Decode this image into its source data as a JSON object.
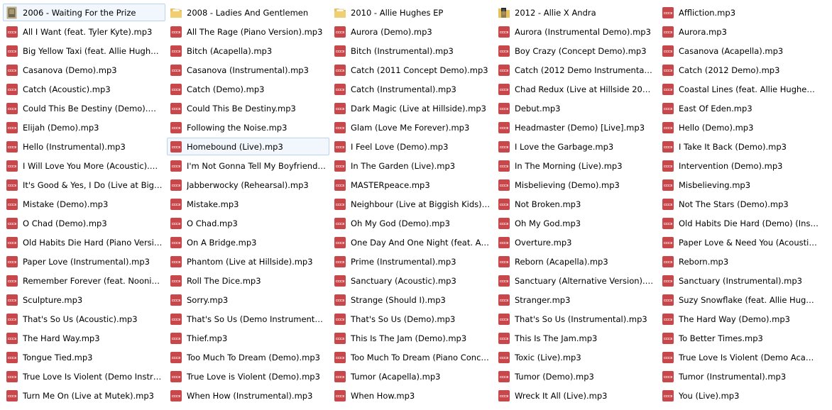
{
  "window": {
    "view": "list"
  },
  "colors": {
    "mp3_icon": "#c8474a",
    "folder": "#e8c060",
    "selection_bg": "#f1f7fd",
    "selection_border": "#b9d4ef"
  },
  "items": [
    {
      "label": "2006 - Waiting For the Prize",
      "type": "folder",
      "icon": "folder-image-icon",
      "state": "selected"
    },
    {
      "label": "All I Want (feat. Tyler Kyte).mp3",
      "type": "mp3",
      "icon": "mp3-file-icon"
    },
    {
      "label": "Big Yellow Taxi (feat. Allie Hughes)....",
      "type": "mp3",
      "icon": "mp3-file-icon"
    },
    {
      "label": "Casanova (Demo).mp3",
      "type": "mp3",
      "icon": "mp3-file-icon"
    },
    {
      "label": "Catch (Acoustic).mp3",
      "type": "mp3",
      "icon": "mp3-file-icon"
    },
    {
      "label": "Could This Be Destiny (Demo).mp3",
      "type": "mp3",
      "icon": "mp3-file-icon"
    },
    {
      "label": "Elijah (Demo).mp3",
      "type": "mp3",
      "icon": "mp3-file-icon"
    },
    {
      "label": "Hello (Instrumental).mp3",
      "type": "mp3",
      "icon": "mp3-file-icon"
    },
    {
      "label": "I Will Love You More (Acoustic).mp3",
      "type": "mp3",
      "icon": "mp3-file-icon"
    },
    {
      "label": "It's Good & Yes, I Do (Live at Biggis...",
      "type": "mp3",
      "icon": "mp3-file-icon"
    },
    {
      "label": "Mistake (Demo).mp3",
      "type": "mp3",
      "icon": "mp3-file-icon"
    },
    {
      "label": "O Chad (Demo).mp3",
      "type": "mp3",
      "icon": "mp3-file-icon"
    },
    {
      "label": "Old Habits Die Hard (Piano Version...",
      "type": "mp3",
      "icon": "mp3-file-icon"
    },
    {
      "label": "Paper Love (Instrumental).mp3",
      "type": "mp3",
      "icon": "mp3-file-icon"
    },
    {
      "label": "Remember Forever (feat. Noonie B...",
      "type": "mp3",
      "icon": "mp3-file-icon"
    },
    {
      "label": "Sculpture.mp3",
      "type": "mp3",
      "icon": "mp3-file-icon"
    },
    {
      "label": "That's So Us (Acoustic).mp3",
      "type": "mp3",
      "icon": "mp3-file-icon"
    },
    {
      "label": "The Hard Way.mp3",
      "type": "mp3",
      "icon": "mp3-file-icon"
    },
    {
      "label": "Tongue Tied.mp3",
      "type": "mp3",
      "icon": "mp3-file-icon"
    },
    {
      "label": "True Love Is Violent (Demo Instrum...",
      "type": "mp3",
      "icon": "mp3-file-icon"
    },
    {
      "label": "Turn Me On (Live at Mutek).mp3",
      "type": "mp3",
      "icon": "mp3-file-icon"
    },
    {
      "label": "2008 - Ladies And Gentlemen",
      "type": "folder",
      "icon": "folder-icon"
    },
    {
      "label": "All The Rage (Piano Version).mp3",
      "type": "mp3",
      "icon": "mp3-file-icon"
    },
    {
      "label": "Bitch (Acapella).mp3",
      "type": "mp3",
      "icon": "mp3-file-icon"
    },
    {
      "label": "Casanova (Instrumental).mp3",
      "type": "mp3",
      "icon": "mp3-file-icon"
    },
    {
      "label": "Catch (Demo).mp3",
      "type": "mp3",
      "icon": "mp3-file-icon"
    },
    {
      "label": "Could This Be Destiny.mp3",
      "type": "mp3",
      "icon": "mp3-file-icon"
    },
    {
      "label": "Following the Noise.mp3",
      "type": "mp3",
      "icon": "mp3-file-icon"
    },
    {
      "label": "Homebound (Live).mp3",
      "type": "mp3",
      "icon": "mp3-file-icon",
      "state": "hover"
    },
    {
      "label": "I'm Not Gonna Tell My Boyfriend (...",
      "type": "mp3",
      "icon": "mp3-file-icon"
    },
    {
      "label": "Jabberwocky (Rehearsal).mp3",
      "type": "mp3",
      "icon": "mp3-file-icon"
    },
    {
      "label": "Mistake.mp3",
      "type": "mp3",
      "icon": "mp3-file-icon"
    },
    {
      "label": "O Chad.mp3",
      "type": "mp3",
      "icon": "mp3-file-icon"
    },
    {
      "label": "On A Bridge.mp3",
      "type": "mp3",
      "icon": "mp3-file-icon"
    },
    {
      "label": "Phantom (Live at Hillside).mp3",
      "type": "mp3",
      "icon": "mp3-file-icon"
    },
    {
      "label": "Roll The Dice.mp3",
      "type": "mp3",
      "icon": "mp3-file-icon"
    },
    {
      "label": "Sorry.mp3",
      "type": "mp3",
      "icon": "mp3-file-icon"
    },
    {
      "label": "That's So Us (Demo Instrumental)....",
      "type": "mp3",
      "icon": "mp3-file-icon"
    },
    {
      "label": "Thief.mp3",
      "type": "mp3",
      "icon": "mp3-file-icon"
    },
    {
      "label": "Too Much To Dream (Demo).mp3",
      "type": "mp3",
      "icon": "mp3-file-icon"
    },
    {
      "label": "True Love is Violent (Demo).mp3",
      "type": "mp3",
      "icon": "mp3-file-icon"
    },
    {
      "label": "When How (Instrumental).mp3",
      "type": "mp3",
      "icon": "mp3-file-icon"
    },
    {
      "label": "2010 - Allie Hughes EP",
      "type": "folder",
      "icon": "folder-icon"
    },
    {
      "label": "Aurora (Demo).mp3",
      "type": "mp3",
      "icon": "mp3-file-icon"
    },
    {
      "label": "Bitch (Instrumental).mp3",
      "type": "mp3",
      "icon": "mp3-file-icon"
    },
    {
      "label": "Catch (2011 Concept Demo).mp3",
      "type": "mp3",
      "icon": "mp3-file-icon"
    },
    {
      "label": "Catch (Instrumental).mp3",
      "type": "mp3",
      "icon": "mp3-file-icon"
    },
    {
      "label": "Dark Magic (Live at Hillside).mp3",
      "type": "mp3",
      "icon": "mp3-file-icon"
    },
    {
      "label": "Glam (Love Me Forever).mp3",
      "type": "mp3",
      "icon": "mp3-file-icon"
    },
    {
      "label": "I Feel Love (Demo).mp3",
      "type": "mp3",
      "icon": "mp3-file-icon"
    },
    {
      "label": "In The Garden (Live).mp3",
      "type": "mp3",
      "icon": "mp3-file-icon"
    },
    {
      "label": "MASTERpeace.mp3",
      "type": "mp3",
      "icon": "mp3-file-icon"
    },
    {
      "label": "Neighbour (Live at Biggish Kids).mp3",
      "type": "mp3",
      "icon": "mp3-file-icon"
    },
    {
      "label": "Oh My God (Demo).mp3",
      "type": "mp3",
      "icon": "mp3-file-icon"
    },
    {
      "label": "One Day And One Night (feat. Allie ...",
      "type": "mp3",
      "icon": "mp3-file-icon"
    },
    {
      "label": "Prime (Instrumental).mp3",
      "type": "mp3",
      "icon": "mp3-file-icon"
    },
    {
      "label": "Sanctuary (Acoustic).mp3",
      "type": "mp3",
      "icon": "mp3-file-icon"
    },
    {
      "label": "Strange (Should I).mp3",
      "type": "mp3",
      "icon": "mp3-file-icon"
    },
    {
      "label": "That's So Us (Demo).mp3",
      "type": "mp3",
      "icon": "mp3-file-icon"
    },
    {
      "label": "This Is The Jam (Demo).mp3",
      "type": "mp3",
      "icon": "mp3-file-icon"
    },
    {
      "label": "Too Much To Dream (Piano Conce...",
      "type": "mp3",
      "icon": "mp3-file-icon"
    },
    {
      "label": "Tumor (Acapella).mp3",
      "type": "mp3",
      "icon": "mp3-file-icon"
    },
    {
      "label": "When How.mp3",
      "type": "mp3",
      "icon": "mp3-file-icon"
    },
    {
      "label": "2012 - Allie X Andra",
      "type": "folder",
      "icon": "folder-dark-icon"
    },
    {
      "label": "Aurora (Instrumental Demo).mp3",
      "type": "mp3",
      "icon": "mp3-file-icon"
    },
    {
      "label": "Boy Crazy (Concept Demo).mp3",
      "type": "mp3",
      "icon": "mp3-file-icon"
    },
    {
      "label": "Catch (2012 Demo Instrumental).m...",
      "type": "mp3",
      "icon": "mp3-file-icon"
    },
    {
      "label": "Chad Redux (Live at Hillside 2012)....",
      "type": "mp3",
      "icon": "mp3-file-icon"
    },
    {
      "label": "Debut.mp3",
      "type": "mp3",
      "icon": "mp3-file-icon"
    },
    {
      "label": "Headmaster (Demo) [Live].mp3",
      "type": "mp3",
      "icon": "mp3-file-icon"
    },
    {
      "label": "I Love the Garbage.mp3",
      "type": "mp3",
      "icon": "mp3-file-icon"
    },
    {
      "label": "In The Morning (Live).mp3",
      "type": "mp3",
      "icon": "mp3-file-icon"
    },
    {
      "label": "Misbelieving (Demo).mp3",
      "type": "mp3",
      "icon": "mp3-file-icon"
    },
    {
      "label": "Not Broken.mp3",
      "type": "mp3",
      "icon": "mp3-file-icon"
    },
    {
      "label": "Oh My God.mp3",
      "type": "mp3",
      "icon": "mp3-file-icon"
    },
    {
      "label": "Overture.mp3",
      "type": "mp3",
      "icon": "mp3-file-icon"
    },
    {
      "label": "Reborn (Acapella).mp3",
      "type": "mp3",
      "icon": "mp3-file-icon"
    },
    {
      "label": "Sanctuary (Alternative Version).mp3",
      "type": "mp3",
      "icon": "mp3-file-icon"
    },
    {
      "label": "Stranger.mp3",
      "type": "mp3",
      "icon": "mp3-file-icon"
    },
    {
      "label": "That's So Us (Instrumental).mp3",
      "type": "mp3",
      "icon": "mp3-file-icon"
    },
    {
      "label": "This Is The Jam.mp3",
      "type": "mp3",
      "icon": "mp3-file-icon"
    },
    {
      "label": "Toxic (Live).mp3",
      "type": "mp3",
      "icon": "mp3-file-icon"
    },
    {
      "label": "Tumor (Demo).mp3",
      "type": "mp3",
      "icon": "mp3-file-icon"
    },
    {
      "label": "Wreck It All (Live).mp3",
      "type": "mp3",
      "icon": "mp3-file-icon"
    },
    {
      "label": "Affliction.mp3",
      "type": "mp3",
      "icon": "mp3-file-icon"
    },
    {
      "label": "Aurora.mp3",
      "type": "mp3",
      "icon": "mp3-file-icon"
    },
    {
      "label": "Casanova (Acapella).mp3",
      "type": "mp3",
      "icon": "mp3-file-icon"
    },
    {
      "label": "Catch (2012 Demo).mp3",
      "type": "mp3",
      "icon": "mp3-file-icon"
    },
    {
      "label": "Coastal Lines (feat. Allie Hughes).m...",
      "type": "mp3",
      "icon": "mp3-file-icon"
    },
    {
      "label": "East Of Eden.mp3",
      "type": "mp3",
      "icon": "mp3-file-icon"
    },
    {
      "label": "Hello (Demo).mp3",
      "type": "mp3",
      "icon": "mp3-file-icon"
    },
    {
      "label": "I Take It Back (Demo).mp3",
      "type": "mp3",
      "icon": "mp3-file-icon"
    },
    {
      "label": "Intervention (Demo).mp3",
      "type": "mp3",
      "icon": "mp3-file-icon"
    },
    {
      "label": "Misbelieving.mp3",
      "type": "mp3",
      "icon": "mp3-file-icon"
    },
    {
      "label": "Not The Stars (Demo).mp3",
      "type": "mp3",
      "icon": "mp3-file-icon"
    },
    {
      "label": "Old Habits Die Hard (Demo) (Instru...",
      "type": "mp3",
      "icon": "mp3-file-icon"
    },
    {
      "label": "Paper Love & Need You (Acoustic, ...",
      "type": "mp3",
      "icon": "mp3-file-icon"
    },
    {
      "label": "Reborn.mp3",
      "type": "mp3",
      "icon": "mp3-file-icon"
    },
    {
      "label": "Sanctuary (Instrumental).mp3",
      "type": "mp3",
      "icon": "mp3-file-icon"
    },
    {
      "label": "Suzy Snowflake (feat. Allie Hughes)...",
      "type": "mp3",
      "icon": "mp3-file-icon"
    },
    {
      "label": "The Hard Way (Demo).mp3",
      "type": "mp3",
      "icon": "mp3-file-icon"
    },
    {
      "label": "To Better Times.mp3",
      "type": "mp3",
      "icon": "mp3-file-icon"
    },
    {
      "label": "True Love Is Violent (Demo Acapell...",
      "type": "mp3",
      "icon": "mp3-file-icon"
    },
    {
      "label": "Tumor (Instrumental).mp3",
      "type": "mp3",
      "icon": "mp3-file-icon"
    },
    {
      "label": "You (Live).mp3",
      "type": "mp3",
      "icon": "mp3-file-icon"
    }
  ]
}
